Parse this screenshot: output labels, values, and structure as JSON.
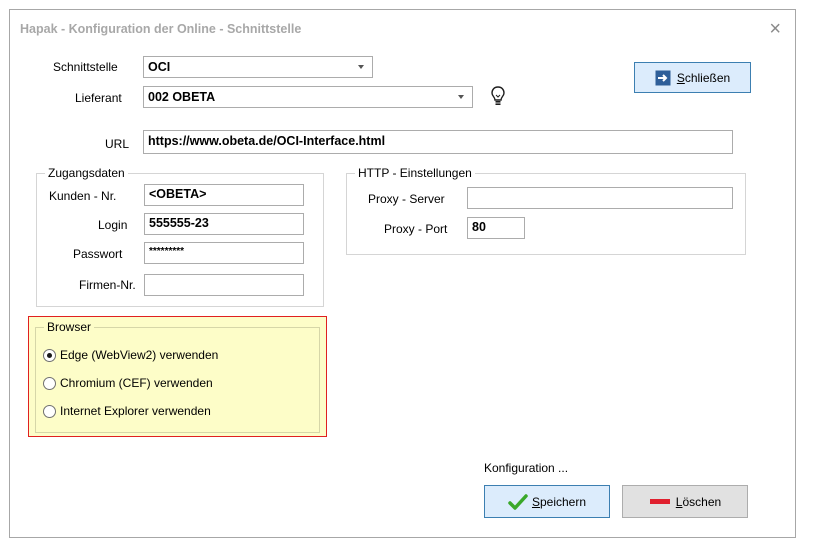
{
  "window": {
    "title": "Hapak - Konfiguration der Online - Schnittstelle",
    "close_glyph": "×"
  },
  "schnittstelle": {
    "label": "Schnittstelle",
    "value": "OCI"
  },
  "lieferant": {
    "label": "Lieferant",
    "value": "002 OBETA"
  },
  "url": {
    "label": "URL",
    "value": "https://www.obeta.de/OCI-Interface.html"
  },
  "zugangsdaten": {
    "legend": "Zugangsdaten",
    "kunden_label": "Kunden - Nr.",
    "kunden_value": "<OBETA>",
    "login_label": "Login",
    "login_value": "555555-23",
    "passwort_label": "Passwort",
    "passwort_value": "*********",
    "firmen_label": "Firmen-Nr.",
    "firmen_value": ""
  },
  "http": {
    "legend": "HTTP - Einstellungen",
    "proxy_server_label": "Proxy - Server",
    "proxy_server_value": "",
    "proxy_port_label": "Proxy - Port",
    "proxy_port_value": "80"
  },
  "browser": {
    "legend": "Browser",
    "options": [
      {
        "label": "Edge (WebView2) verwenden",
        "selected": true
      },
      {
        "label": "Chromium (CEF) verwenden",
        "selected": false
      },
      {
        "label": "Internet Explorer verwenden",
        "selected": false
      }
    ]
  },
  "buttons": {
    "schliessen_first": "S",
    "schliessen_rest": "chließen",
    "konfiguration_label": "Konfiguration ...",
    "speichern_first": "S",
    "speichern_rest": "peichern",
    "loeschen_first": "L",
    "loeschen_rest": "öschen"
  },
  "colors": {
    "accent": "#3c7fb1",
    "highlight_border": "#e02020",
    "highlight_bg": "#fdfdc8",
    "save_check": "#3aa82a",
    "delete_bar": "#e0202e"
  },
  "icons": {
    "close": "close-icon",
    "lightbulb": "lightbulb-icon",
    "exit": "exit-icon",
    "check": "check-icon",
    "minus": "minus-icon"
  }
}
